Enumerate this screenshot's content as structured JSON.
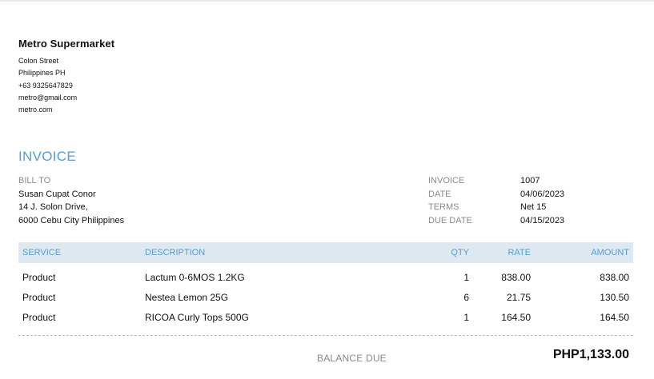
{
  "company": {
    "name": "Metro Supermarket",
    "lines": [
      "Colon Street",
      "Philippines PH",
      "+63 9325647829",
      "metro@gmail.com",
      "metro.com"
    ]
  },
  "invoice_title": "INVOICE",
  "bill_to": {
    "label": "BILL TO",
    "name": "Susan Cupat Conor",
    "address1": "14 J. Solon Drive,",
    "address2": "6000 Cebu City Philippines"
  },
  "meta": [
    {
      "label": "INVOICE",
      "value": "1007"
    },
    {
      "label": "DATE",
      "value": "04/06/2023"
    },
    {
      "label": "TERMS",
      "value": "Net 15"
    },
    {
      "label": "DUE DATE",
      "value": "04/15/2023"
    }
  ],
  "table": {
    "headers": {
      "service": "SERVICE",
      "description": "DESCRIPTION",
      "qty": "QTY",
      "rate": "RATE",
      "amount": "AMOUNT"
    },
    "rows": [
      {
        "service": "Product",
        "description": "Lactum 0-6MOS 1.2KG",
        "qty": "1",
        "rate": "838.00",
        "amount": "838.00"
      },
      {
        "service": "Product",
        "description": "Nestea Lemon 25G",
        "qty": "6",
        "rate": "21.75",
        "amount": "130.50"
      },
      {
        "service": "Product",
        "description": "RICOA Curly Tops 500G",
        "qty": "1",
        "rate": "164.50",
        "amount": "164.50"
      }
    ]
  },
  "balance": {
    "label": "BALANCE DUE",
    "value": "PHP1,133.00"
  },
  "colors": {
    "accent": "#5a9bc8",
    "header_bg": "#dde8f0",
    "muted": "#8a8a8a"
  }
}
